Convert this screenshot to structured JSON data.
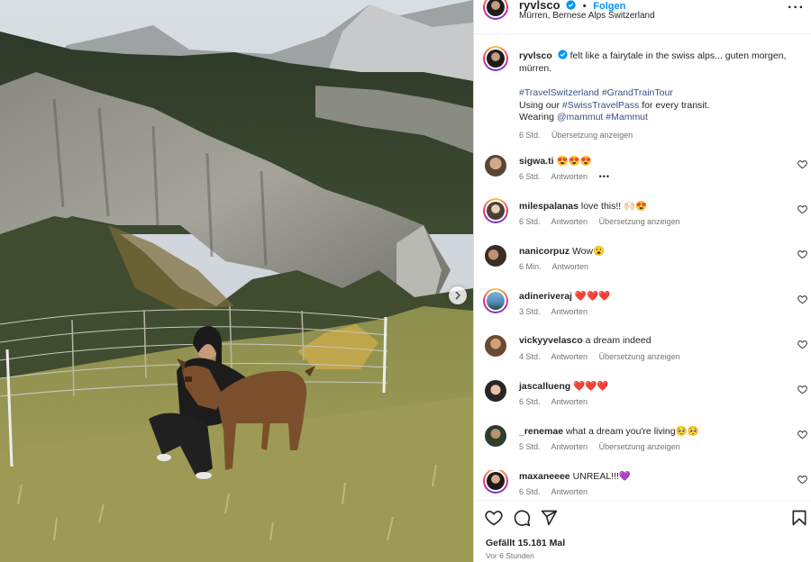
{
  "header": {
    "username": "ryvlsco",
    "separator": "•",
    "follow_label": "Folgen",
    "location": "Mürren, Bernese Alps Switzerland",
    "more_label": "···"
  },
  "caption": {
    "username": "ryvlsco",
    "line1": "felt like a fairytale in the swiss alps... guten morgen,",
    "line2": "mürren.",
    "tag1": "#TravelSwitzerland",
    "tag2": "#GrandTrainTour",
    "line3_a": "Using our",
    "tag3": "#SwissTravelPass",
    "line3_b": "for every transit.",
    "line4_a": "Wearing",
    "tag4": "@mammut",
    "tag5": "#Mammut",
    "time": "6 Std.",
    "translate": "Übersetzung anzeigen"
  },
  "comments": [
    {
      "user": "sigwa.ti",
      "text": "😍😍😍",
      "time": "6 Std.",
      "reply": "Antworten",
      "translate": "",
      "extra": "•••"
    },
    {
      "user": "milespalanas",
      "text": "love this!! 🙌🏻😍",
      "time": "6 Std.",
      "reply": "Antworten",
      "translate": "Übersetzung anzeigen",
      "extra": ""
    },
    {
      "user": "nanicorpuz",
      "text": "Wow😮",
      "time": "6 Min.",
      "reply": "Antworten",
      "translate": "",
      "extra": ""
    },
    {
      "user": "adineriveraj",
      "text": "❤️❤️❤️",
      "time": "3 Std.",
      "reply": "Antworten",
      "translate": "",
      "extra": ""
    },
    {
      "user": "vickyyvelasco",
      "text": "a dream indeed",
      "time": "4 Std.",
      "reply": "Antworten",
      "translate": "Übersetzung anzeigen",
      "extra": ""
    },
    {
      "user": "jascallueng",
      "text": "❤️❤️❤️",
      "time": "6 Std.",
      "reply": "Antworten",
      "translate": "",
      "extra": ""
    },
    {
      "user": "_renemae",
      "text": "what a dream you're living🥺🥺",
      "time": "5 Std.",
      "reply": "Antworten",
      "translate": "Übersetzung anzeigen",
      "extra": ""
    },
    {
      "user": "maxaneeee",
      "text": "UNREAL!!!💜",
      "time": "6 Std.",
      "reply": "Antworten",
      "translate": "",
      "extra": ""
    }
  ],
  "footer": {
    "likes": "Gefällt 15.181 Mal",
    "ago": "Vor 6 Stunden"
  },
  "icons": {
    "like": "heart-icon",
    "comment": "comment-icon",
    "share": "share-icon",
    "save": "bookmark-icon",
    "verified": "verified-badge-icon",
    "next": "chevron-right-icon"
  },
  "colors": {
    "link": "#0095f6",
    "hashtag": "#385185",
    "muted": "#737373",
    "text": "#262626"
  }
}
